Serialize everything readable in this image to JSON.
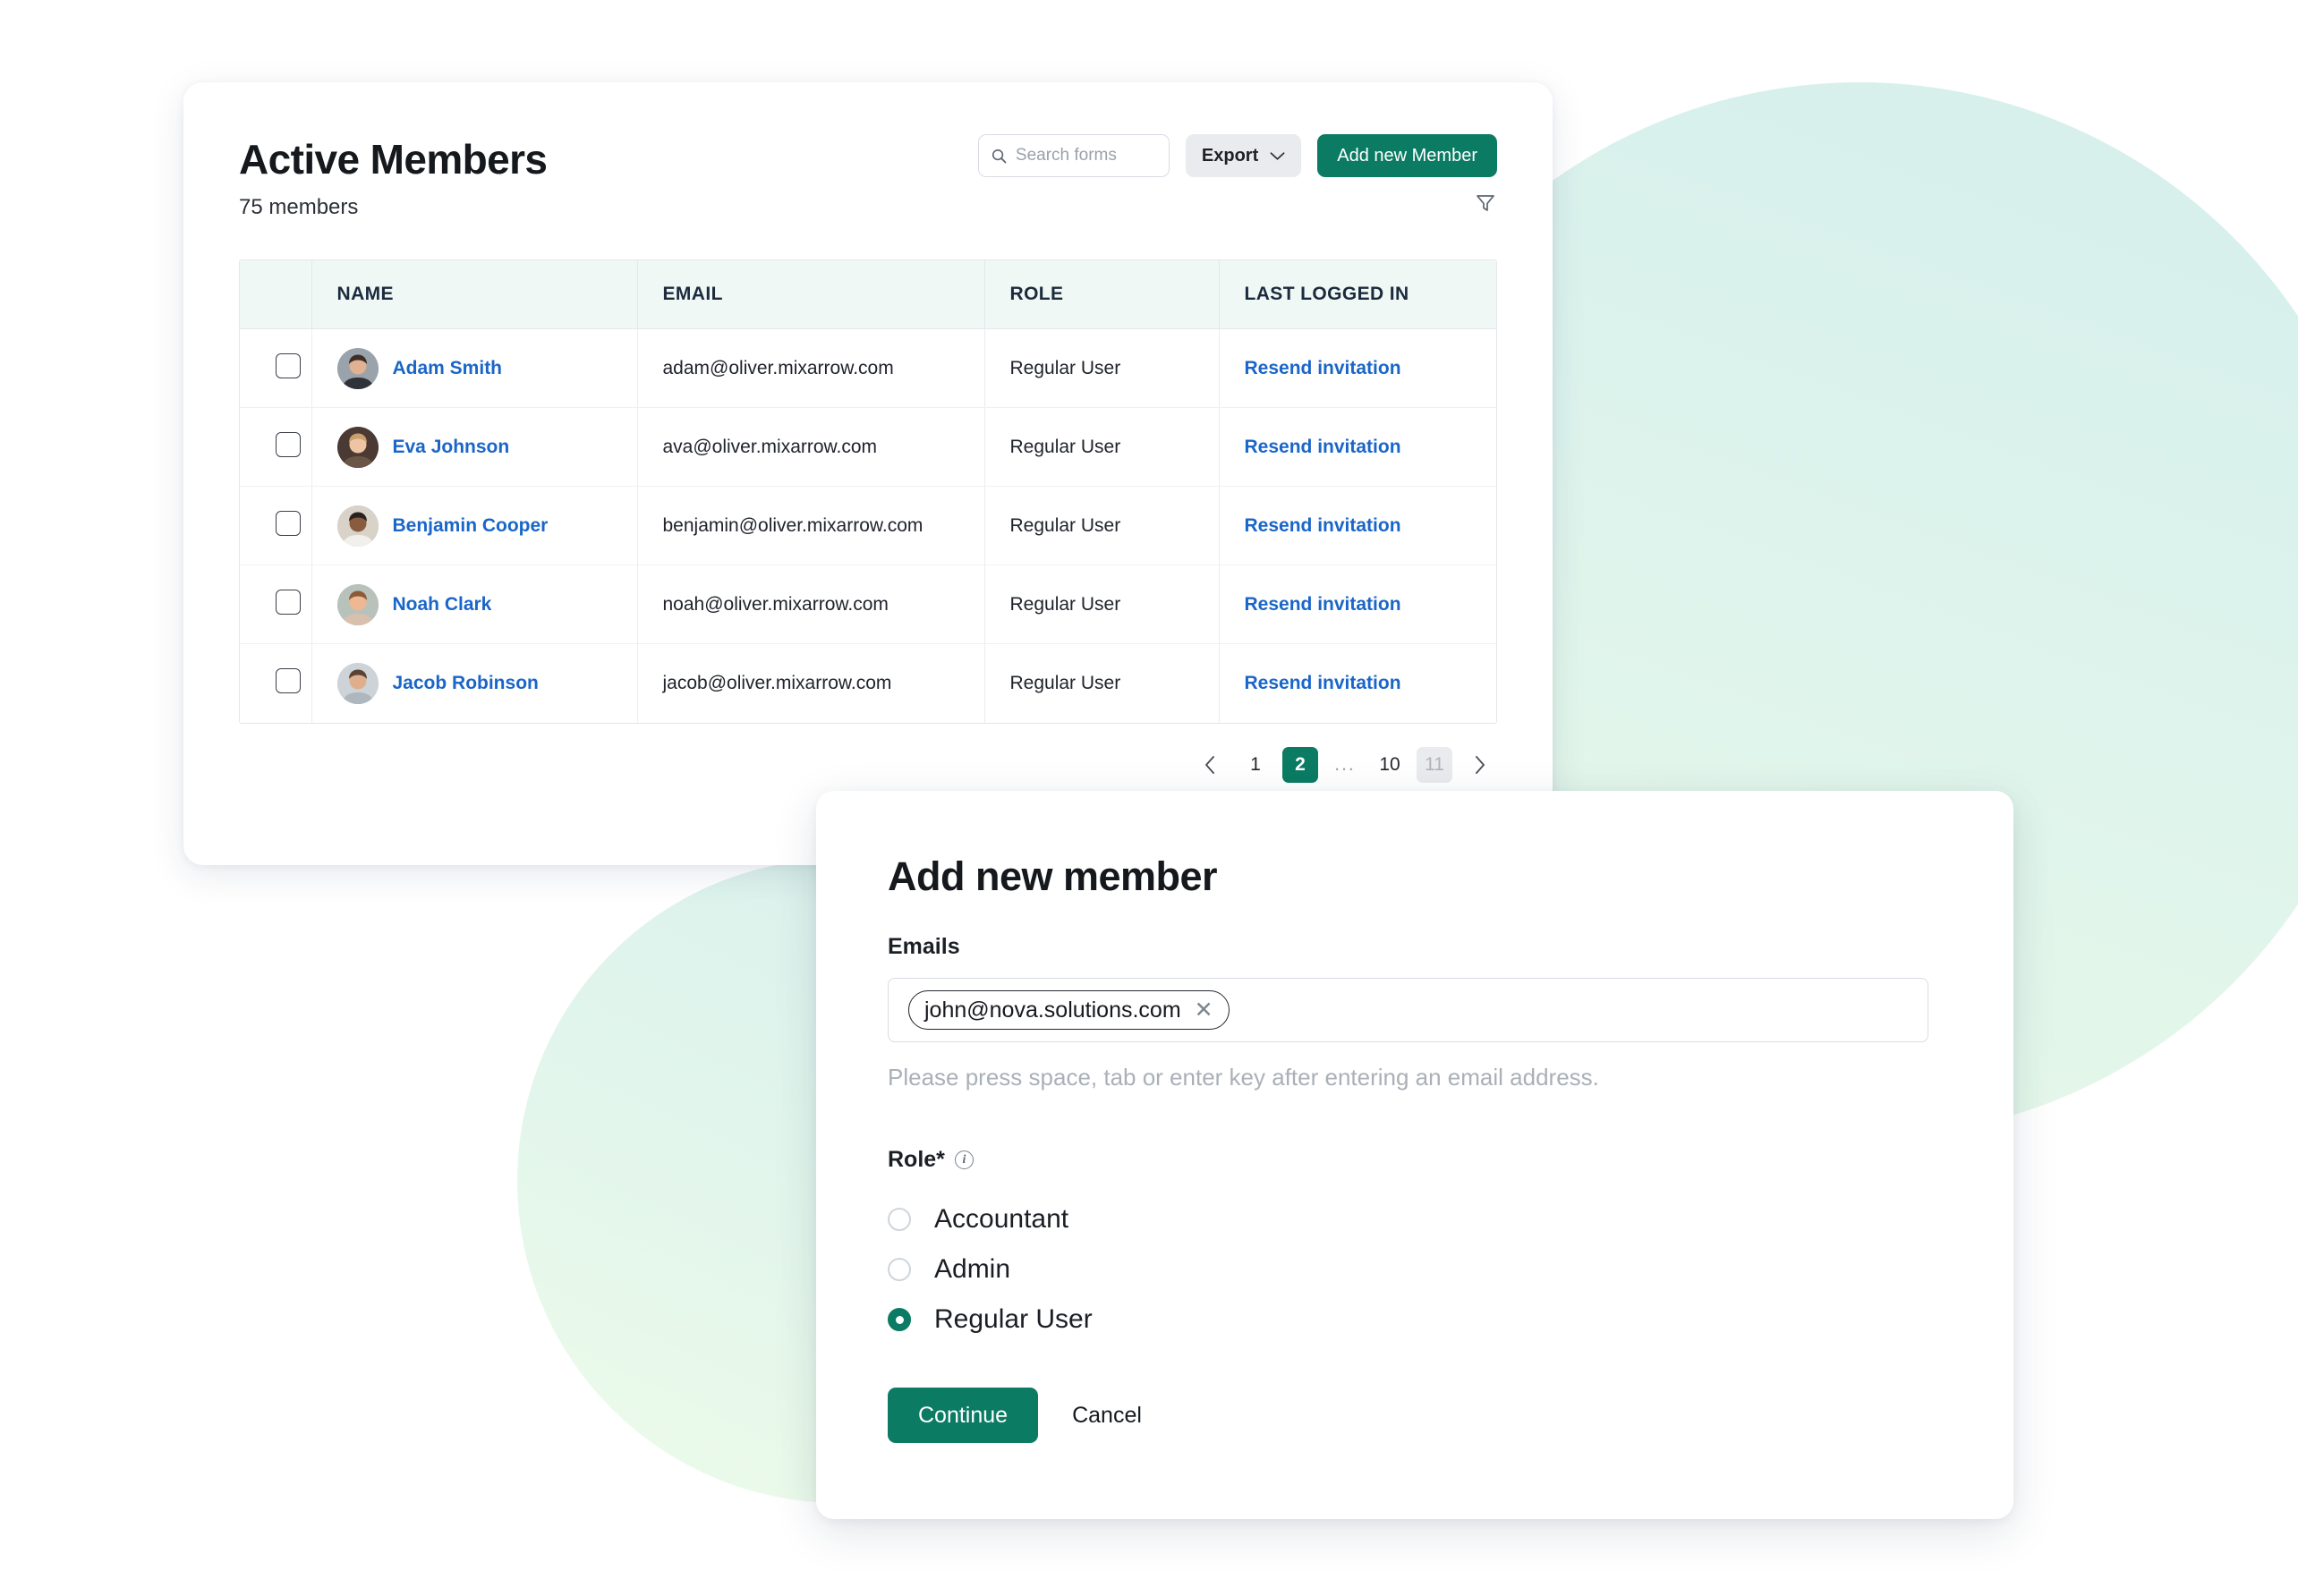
{
  "background": {
    "circle_large_color": "#d9f1ec",
    "circle_small_color": "#e0f4ec"
  },
  "members_card": {
    "title": "Active Members",
    "subtitle": "75 members",
    "toolbar": {
      "search_placeholder": "Search forms",
      "search_value": "",
      "search_icon": "search-icon",
      "export_label": "Export",
      "export_caret_icon": "chevron-down-icon",
      "add_member_label": "Add new Member",
      "filter_icon": "filter-funnel-icon"
    },
    "table": {
      "columns": [
        "NAME",
        "EMAIL",
        "ROLE",
        "LAST LOGGED IN"
      ],
      "rows": [
        {
          "checked": false,
          "name": "Adam Smith",
          "email": "adam@oliver.mixarrow.com",
          "role": "Regular User",
          "last_logged_in": "Resend invitation",
          "avatar_hair": "#3d2f26",
          "avatar_skin": "#e0b291",
          "avatar_bg": "#9aa3ab",
          "avatar_shirt": "#2f3238"
        },
        {
          "checked": false,
          "name": "Eva Johnson",
          "email": "ava@oliver.mixarrow.com",
          "role": "Regular User",
          "last_logged_in": "Resend invitation",
          "avatar_hair": "#c9a06a",
          "avatar_skin": "#eec5a4",
          "avatar_bg": "#4a3a33",
          "avatar_shirt": "#6b5546"
        },
        {
          "checked": false,
          "name": "Benjamin Cooper",
          "email": "benjamin@oliver.mixarrow.com",
          "role": "Regular User",
          "last_logged_in": "Resend invitation",
          "avatar_hair": "#2a2220",
          "avatar_skin": "#8a5c3f",
          "avatar_bg": "#d8d2c8",
          "avatar_shirt": "#f2f0ec"
        },
        {
          "checked": false,
          "name": "Noah Clark",
          "email": "noah@oliver.mixarrow.com",
          "role": "Regular User",
          "last_logged_in": "Resend invitation",
          "avatar_hair": "#8c5a36",
          "avatar_skin": "#eeb894",
          "avatar_bg": "#b8c2bb",
          "avatar_shirt": "#d8c0ae"
        },
        {
          "checked": false,
          "name": "Jacob Robinson",
          "email": "jacob@oliver.mixarrow.com",
          "role": "Regular User",
          "last_logged_in": "Resend invitation",
          "avatar_hair": "#5a4334",
          "avatar_skin": "#dfae8c",
          "avatar_bg": "#cdd3d6",
          "avatar_shirt": "#aeb7bd"
        }
      ]
    },
    "pagination": {
      "prev_icon": "chevron-left-icon",
      "next_icon": "chevron-right-icon",
      "pages": [
        "1",
        "2",
        "...",
        "10",
        "11"
      ],
      "active_page": "2",
      "disabled_page": "11"
    }
  },
  "modal": {
    "title": "Add new member",
    "emails_label": "Emails",
    "email_chip": "john@nova.solutions.com",
    "chip_remove_icon": "close-icon",
    "hint": "Please press space, tab or enter key after entering an email address.",
    "role_label": "Role*",
    "role_info_icon": "info-icon",
    "roles": [
      "Accountant",
      "Admin",
      "Regular User"
    ],
    "selected_role": "Regular User",
    "continue_label": "Continue",
    "cancel_label": "Cancel"
  },
  "colors": {
    "accent_green": "#0b7b63",
    "link_blue": "#1a66c8",
    "header_bg": "#f0f8f6"
  }
}
